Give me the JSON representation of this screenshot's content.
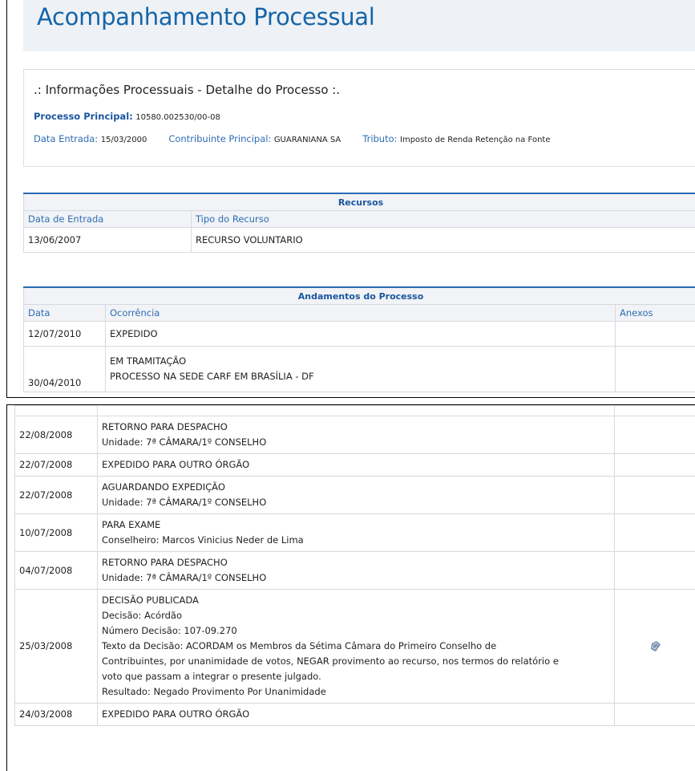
{
  "page_title": "Acompanhamento Processual",
  "info": {
    "heading": ".: Informações Processuais - Detalhe do Processo :.",
    "processo_label": "Processo Principal:",
    "processo_value": "10580.002530/00-08",
    "data_entrada_label": "Data Entrada:",
    "data_entrada_value": "15/03/2000",
    "contribuinte_label": "Contribuinte Principal:",
    "contribuinte_value": "GUARANIANA SA",
    "tributo_label": "Tributo:",
    "tributo_value": "Imposto de Renda Retenção na Fonte"
  },
  "recursos": {
    "caption": "Recursos",
    "headers": [
      "Data de Entrada",
      "Tipo do Recurso"
    ],
    "rows": [
      {
        "data": "13/06/2007",
        "tipo": "RECURSO VOLUNTARIO"
      }
    ]
  },
  "andamentos": {
    "caption": "Andamentos do Processo",
    "headers": [
      "Data",
      "Ocorrência",
      "Anexos"
    ],
    "rows": [
      {
        "data": "12/07/2010",
        "lines": [
          "EXPEDIDO"
        ],
        "anexo": false
      },
      {
        "data": "30/04/2010",
        "lines": [
          "EM TRAMITAÇÃO",
          "PROCESSO NA SEDE CARF EM BRASÍLIA - DF"
        ],
        "anexo": false
      }
    ],
    "rows_continued": [
      {
        "data": "22/08/2008",
        "lines": [
          "RETORNO PARA DESPACHO",
          "Unidade: 7ª CÂMARA/1º CONSELHO"
        ],
        "anexo": false
      },
      {
        "data": "22/07/2008",
        "lines": [
          "EXPEDIDO PARA OUTRO ÓRGÃO"
        ],
        "anexo": false
      },
      {
        "data": "22/07/2008",
        "lines": [
          "AGUARDANDO EXPEDIÇÃO",
          "Unidade: 7ª CÂMARA/1º CONSELHO"
        ],
        "anexo": false
      },
      {
        "data": "10/07/2008",
        "lines": [
          "PARA EXAME",
          "Conselheiro: Marcos Vinicius Neder de Lima"
        ],
        "anexo": false
      },
      {
        "data": "04/07/2008",
        "lines": [
          "RETORNO PARA DESPACHO",
          "Unidade: 7ª CÂMARA/1º CONSELHO"
        ],
        "anexo": false
      },
      {
        "data": "25/03/2008",
        "lines": [
          "DECISÃO PUBLICADA",
          "Decisão: Acórdão",
          "Número Decisão: 107-09.270",
          "Texto da Decisão: ACORDAM os Membros da Sétima Câmara do Primeiro Conselho de",
          "Contribuintes, por unanimidade de votos, NEGAR provimento ao recurso, nos termos do relatório e",
          "voto que passam a integrar o presente julgado.",
          "Resultado: Negado Provimento Por Unanimidade"
        ],
        "anexo": true,
        "anexo_icon": "document-attachment-icon"
      },
      {
        "data": "24/03/2008",
        "lines": [
          "EXPEDIDO PARA OUTRO ÓRGÃO"
        ],
        "anexo": false
      }
    ]
  },
  "colors": {
    "title_blue": "#1565a8",
    "label_blue": "#2f6db5",
    "caption_border": "#2a6bb5",
    "header_bg": "#f1f3f6",
    "banner_bg": "#eef1f5"
  }
}
